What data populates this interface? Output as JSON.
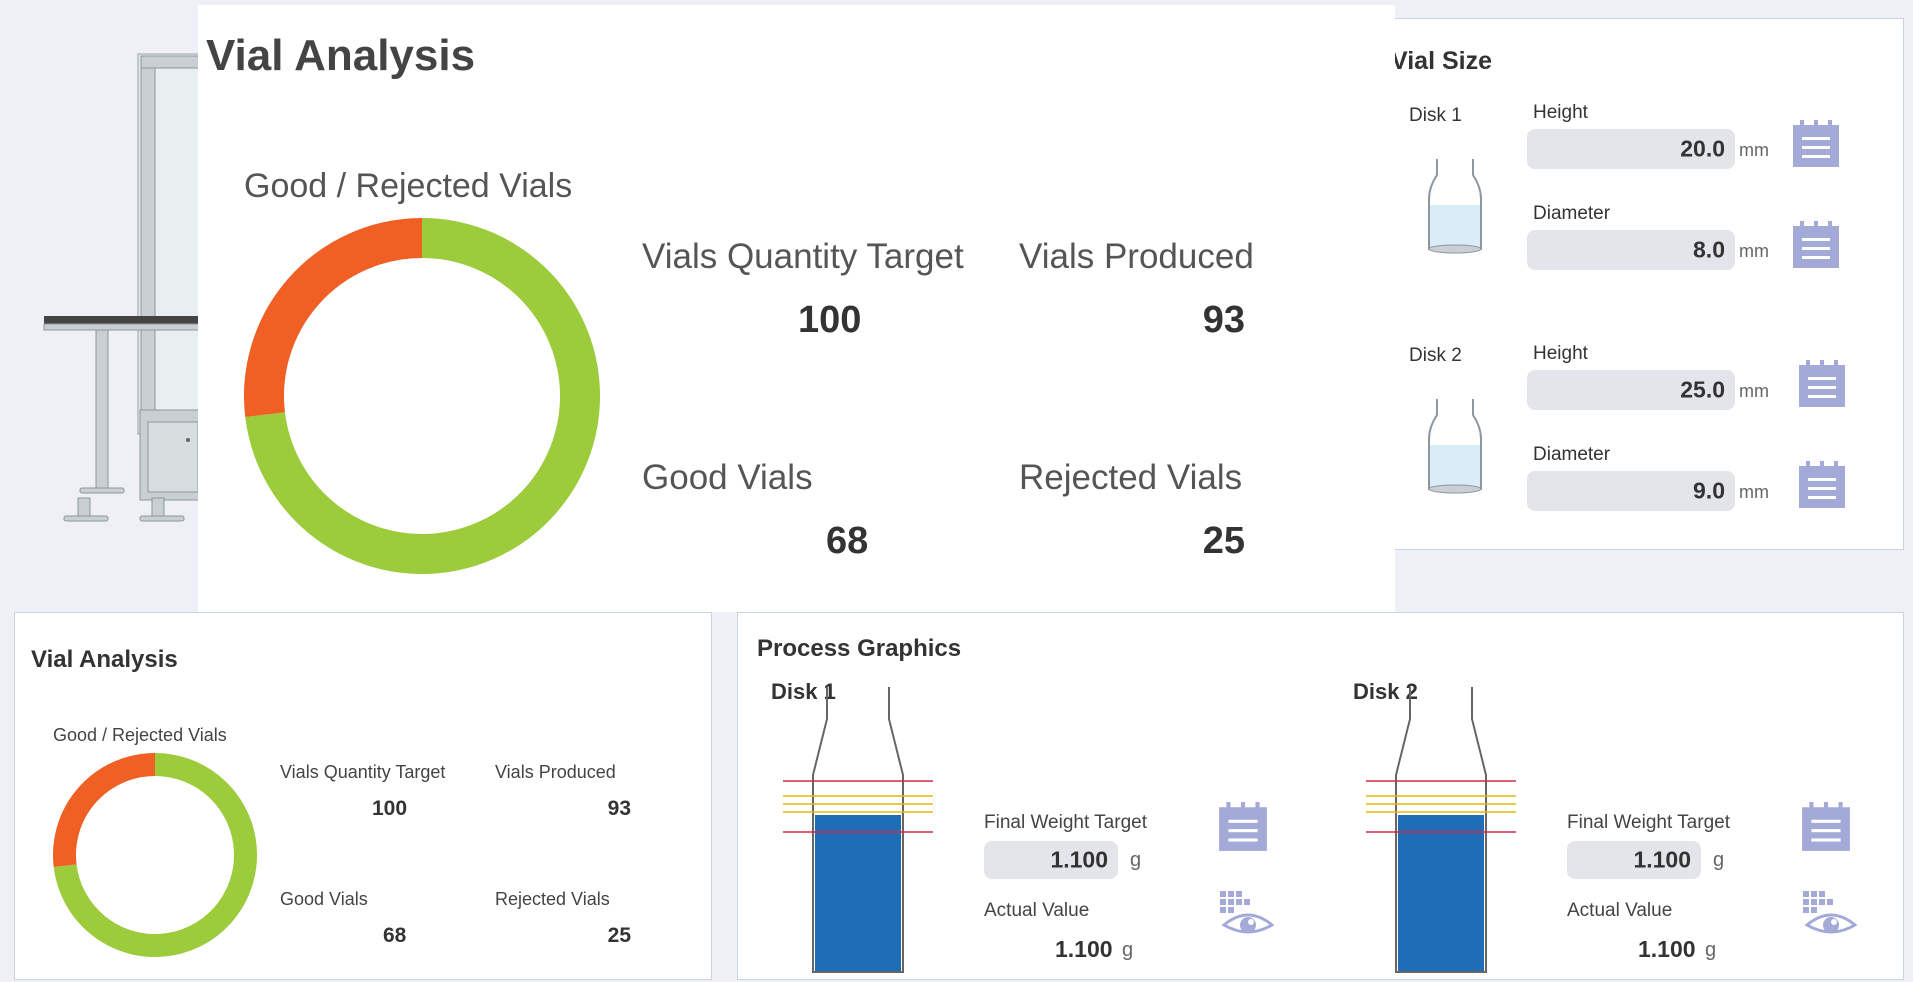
{
  "vial_size": {
    "title": "Vial Size",
    "disk1": {
      "label": "Disk 1",
      "height_label": "Height",
      "height_value": "20.0",
      "height_unit": "mm",
      "diameter_label": "Diameter",
      "diameter_value": "8.0",
      "diameter_unit": "mm"
    },
    "disk2": {
      "label": "Disk 2",
      "height_label": "Height",
      "height_value": "25.0",
      "height_unit": "mm",
      "diameter_label": "Diameter",
      "diameter_value": "9.0",
      "diameter_unit": "mm"
    }
  },
  "vial_analysis_large": {
    "title": "Vial Analysis",
    "donut_title": "Good / Rejected Vials",
    "target_label": "Vials Quantity Target",
    "target_value": "100",
    "produced_label": "Vials Produced",
    "produced_value": "93",
    "good_label": "Good Vials",
    "good_value": "68",
    "rejected_label": "Rejected Vials",
    "rejected_value": "25"
  },
  "vial_analysis_small": {
    "title": "Vial Analysis",
    "donut_title": "Good / Rejected Vials",
    "target_label": "Vials Quantity Target",
    "target_value": "100",
    "produced_label": "Vials Produced",
    "produced_value": "93",
    "good_label": "Good Vials",
    "good_value": "68",
    "rejected_label": "Rejected Vials",
    "rejected_value": "25"
  },
  "process_graphics": {
    "title": "Process Graphics",
    "disk1": {
      "label": "Disk 1",
      "fwt_label": "Final Weight Target",
      "fwt_value": "1.100",
      "fwt_unit": "g",
      "actual_label": "Actual Value",
      "actual_value": "1.100",
      "actual_unit": "g"
    },
    "disk2": {
      "label": "Disk 2",
      "fwt_label": "Final Weight Target",
      "fwt_value": "1.100",
      "fwt_unit": "g",
      "actual_label": "Actual Value",
      "actual_value": "1.100",
      "actual_unit": "g"
    }
  },
  "chart_data": [
    {
      "type": "pie",
      "categories": [
        "Good Vials",
        "Rejected Vials"
      ],
      "values": [
        68,
        25
      ],
      "colors": [
        "#9ccb3b",
        "#f05f24"
      ],
      "title": "Good / Rejected Vials"
    },
    {
      "type": "pie",
      "categories": [
        "Good Vials",
        "Rejected Vials"
      ],
      "values": [
        68,
        25
      ],
      "colors": [
        "#9ccb3b",
        "#f05f24"
      ],
      "title": "Good / Rejected Vials"
    }
  ],
  "colors": {
    "good": "#9ccb3b",
    "rejected": "#f05f24",
    "fill": "#1f6db5",
    "icon": "#a3aad8"
  },
  "icons": [
    "notepad-icon",
    "eye-icon",
    "vial-icon",
    "machine-illustration"
  ]
}
